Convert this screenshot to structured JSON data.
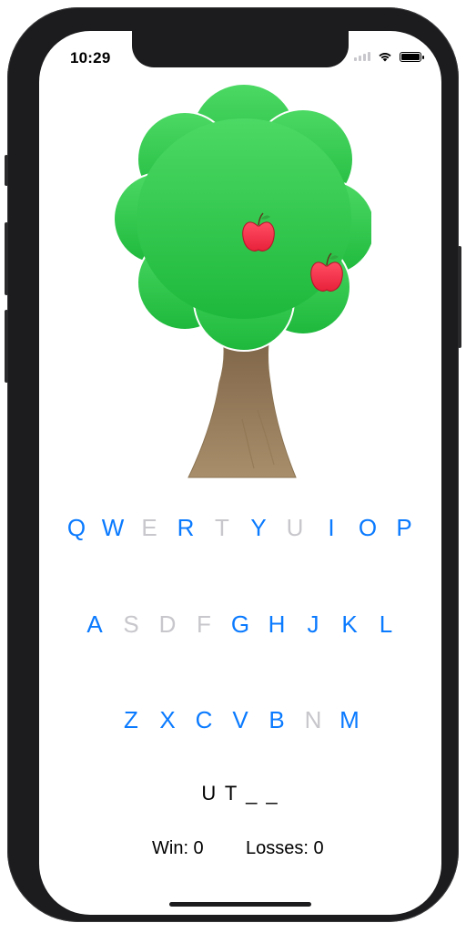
{
  "status_bar": {
    "time": "10:29"
  },
  "keyboard": {
    "rows": [
      [
        {
          "letter": "Q",
          "enabled": true
        },
        {
          "letter": "W",
          "enabled": true
        },
        {
          "letter": "E",
          "enabled": false
        },
        {
          "letter": "R",
          "enabled": true
        },
        {
          "letter": "T",
          "enabled": false
        },
        {
          "letter": "Y",
          "enabled": true
        },
        {
          "letter": "U",
          "enabled": false
        },
        {
          "letter": "I",
          "enabled": true
        },
        {
          "letter": "O",
          "enabled": true
        },
        {
          "letter": "P",
          "enabled": true
        }
      ],
      [
        {
          "letter": "A",
          "enabled": true
        },
        {
          "letter": "S",
          "enabled": false
        },
        {
          "letter": "D",
          "enabled": false
        },
        {
          "letter": "F",
          "enabled": false
        },
        {
          "letter": "G",
          "enabled": true
        },
        {
          "letter": "H",
          "enabled": true
        },
        {
          "letter": "J",
          "enabled": true
        },
        {
          "letter": "K",
          "enabled": true
        },
        {
          "letter": "L",
          "enabled": true
        }
      ],
      [
        {
          "letter": "Z",
          "enabled": true
        },
        {
          "letter": "X",
          "enabled": true
        },
        {
          "letter": "C",
          "enabled": true
        },
        {
          "letter": "V",
          "enabled": true
        },
        {
          "letter": "B",
          "enabled": true
        },
        {
          "letter": "N",
          "enabled": false
        },
        {
          "letter": "M",
          "enabled": true
        }
      ]
    ]
  },
  "game": {
    "word_display": "U T _ _",
    "wins_label": "Win: 0",
    "losses_label": "Losses: 0",
    "apples_remaining": 2
  },
  "colors": {
    "key_enabled": "#0a7aff",
    "key_disabled": "#c7c7cc",
    "foliage": "#35c759",
    "trunk": "#8b6f4e",
    "apple": "#ff2d55"
  }
}
